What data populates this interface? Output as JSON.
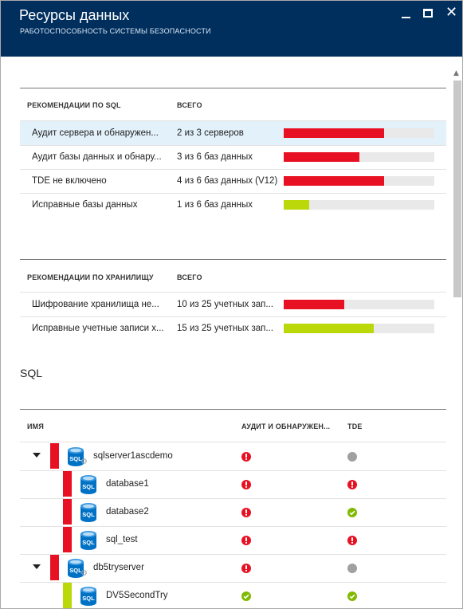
{
  "window": {
    "title": "Ресурсы данных",
    "subtitle": "РАБОТОСПОСОБНОСТЬ СИСТЕМЫ БЕЗОПАСНОСТИ"
  },
  "controls": {
    "minimize_icon": "minimize-icon",
    "maximize_icon": "maximize-icon",
    "close_glyph": "✕"
  },
  "colors": {
    "header_bg": "#002f5e",
    "danger": "#e81123",
    "success": "#bad80a",
    "neutral": "#a0a0a0",
    "check_green": "#7fba00",
    "selected_row": "#e3f1fb",
    "sql_icon_blue": "#0072c6"
  },
  "sql_recommendations": {
    "col_name": "РЕКОМЕНДАЦИИ ПО SQL",
    "col_total": "ВСЕГО",
    "rows": [
      {
        "name": "Аудит сервера и обнаружен...",
        "total": "2 из 3 серверов",
        "fraction": 0.667,
        "status": "danger",
        "selected": true
      },
      {
        "name": "Аудит базы данных и обнару...",
        "total": "3 из 6 баз данных",
        "fraction": 0.5,
        "status": "danger",
        "selected": false
      },
      {
        "name": "TDE не включено",
        "total": "4 из 6 баз данных (V12)",
        "fraction": 0.667,
        "status": "danger",
        "selected": false
      },
      {
        "name": "Исправные базы данных",
        "total": "1 из 6 баз данных",
        "fraction": 0.167,
        "status": "success",
        "selected": false
      }
    ]
  },
  "storage_recommendations": {
    "col_name": "РЕКОМЕНДАЦИИ ПО ХРАНИЛИЩУ",
    "col_total": "ВСЕГО",
    "rows": [
      {
        "name": "Шифрование хранилища не...",
        "total": "10 из 25 учетных зап...",
        "fraction": 0.4,
        "status": "danger",
        "selected": false
      },
      {
        "name": "Исправные учетные записи х...",
        "total": "15 из 25 учетных зап...",
        "fraction": 0.6,
        "status": "success",
        "selected": false
      }
    ]
  },
  "sql_section": {
    "title": "SQL",
    "col_name": "ИМЯ",
    "col_audit": "АУДИТ И ОБНАРУЖЕН...",
    "col_tde": "TDE",
    "icon_label": "SQL",
    "rows": [
      {
        "name": "sqlserver1ascdemo",
        "type": "server",
        "expanded": true,
        "status": "danger",
        "audit": "error",
        "tde": "neutral"
      },
      {
        "name": "database1",
        "type": "database",
        "status": "danger",
        "audit": "error",
        "tde": "error"
      },
      {
        "name": "database2",
        "type": "database",
        "status": "danger",
        "audit": "error",
        "tde": "ok"
      },
      {
        "name": "sql_test",
        "type": "database",
        "status": "danger",
        "audit": "error",
        "tde": "error"
      },
      {
        "name": "db5tryserver",
        "type": "server",
        "expanded": true,
        "status": "danger",
        "audit": "error",
        "tde": "neutral"
      },
      {
        "name": "DV5SecondTry",
        "type": "database",
        "status": "success",
        "audit": "ok",
        "tde": "ok"
      }
    ]
  }
}
